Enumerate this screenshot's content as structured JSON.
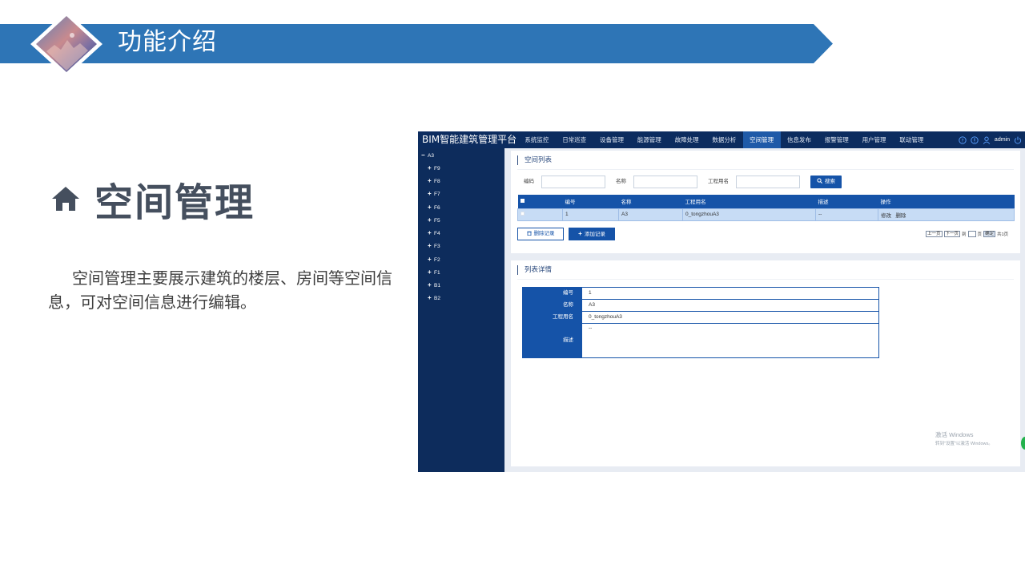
{
  "slide": {
    "header_title": "功能介绍",
    "section_title": "空间管理",
    "section_description": "空间管理主要展示建筑的楼层、房间等空间信息，可对空间信息进行编辑。"
  },
  "app": {
    "title": "BIM智能建筑管理平台",
    "nav": [
      "系统监控",
      "日常巡查",
      "设备管理",
      "能源管理",
      "故障处理",
      "数据分析",
      "空间管理",
      "信息发布",
      "报警管理",
      "用户管理",
      "联动管理"
    ],
    "active_nav": "空间管理",
    "user": "admin",
    "sidebar": {
      "root": "A3",
      "floors": [
        "F9",
        "F8",
        "F7",
        "F6",
        "F5",
        "F4",
        "F3",
        "F2",
        "F1",
        "B1",
        "B2"
      ]
    },
    "list_panel": {
      "title": "空间列表",
      "filters": {
        "code_label": "编码",
        "name_label": "名称",
        "project_name_label": "工程用名",
        "search_button": "搜索"
      },
      "columns": [
        "编号",
        "名称",
        "工程用名",
        "描述",
        "操作"
      ],
      "rows": [
        {
          "id": "1",
          "name": "A3",
          "project_name": "0_tongzhouA3",
          "desc": "--",
          "edit": "修改",
          "delete": "删除"
        }
      ],
      "delete_button": "删除记录",
      "add_button": "添加记录",
      "pager": {
        "prev": "上一页",
        "next": "下一页",
        "jump_prefix": "到",
        "jump_suffix": "页",
        "confirm": "确定",
        "total": "共1页"
      }
    },
    "detail_panel": {
      "title": "列表详情",
      "fields": [
        {
          "label": "编号",
          "value": "1"
        },
        {
          "label": "名称",
          "value": "A3"
        },
        {
          "label": "工程用名",
          "value": "0_tongzhouA3"
        },
        {
          "label": "描述",
          "value": "--"
        }
      ]
    },
    "watermark": {
      "line1": "激活 Windows",
      "line2": "转到\"设置\"以激活 Windows。"
    }
  },
  "colors": {
    "band_blue": "#2e75b6",
    "app_navy": "#0c2c5f",
    "primary_blue": "#1553a8",
    "title_gray": "#454f5e"
  }
}
